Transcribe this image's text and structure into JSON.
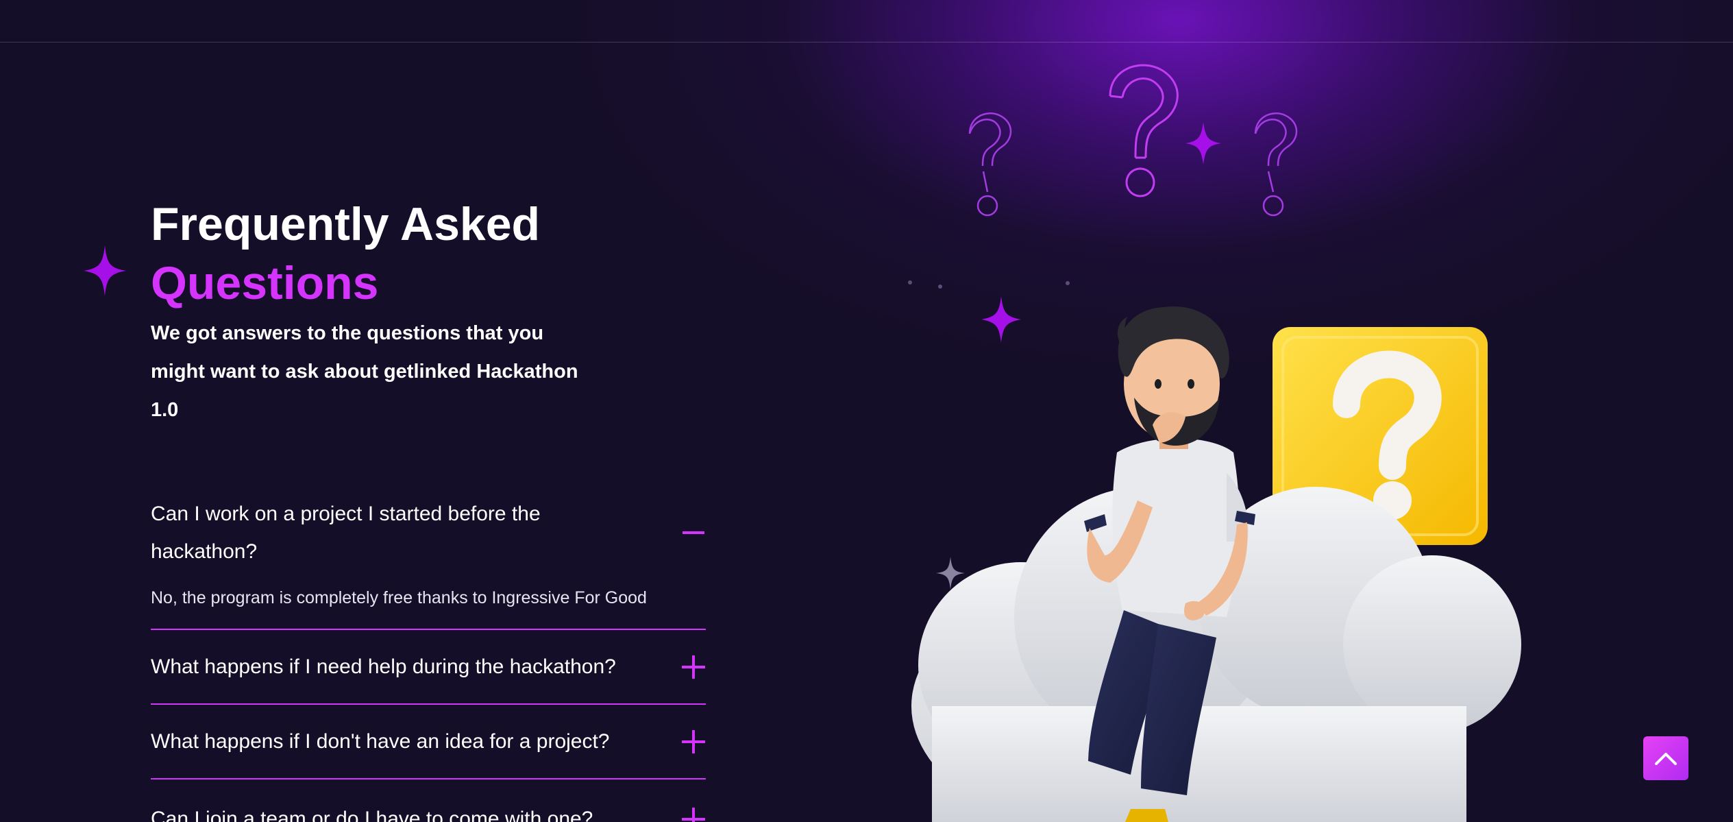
{
  "hero": {
    "title_line1": "Frequently Asked",
    "title_line2": "Questions",
    "subtitle": "We got answers to the questions that you might want to ask about getlinked Hackathon 1.0"
  },
  "faq": {
    "items": [
      {
        "question": "Can I work on a project I started before the hackathon?",
        "answer": "No, the program is completely free thanks to Ingressive For Good",
        "state": "expanded",
        "toggle_icon": "minus-icon"
      },
      {
        "question": "What happens if I need help during the hackathon?",
        "state": "collapsed",
        "toggle_icon": "plus-icon"
      },
      {
        "question": "What happens if I don't have an idea for a project?",
        "state": "collapsed",
        "toggle_icon": "plus-icon"
      },
      {
        "question": "Can I join a team or do I have to come with one?",
        "state": "collapsed",
        "toggle_icon": "plus-icon"
      }
    ]
  },
  "scroll_top": {
    "icon": "chevron-up-icon"
  },
  "illustration": {
    "icon": "thinking-man-on-cloud-with-question-bubble"
  },
  "colors": {
    "background": "#150e28",
    "accent": "#d434fe",
    "glow": "#6e12be",
    "bubble_yellow": "#ffcc00"
  }
}
